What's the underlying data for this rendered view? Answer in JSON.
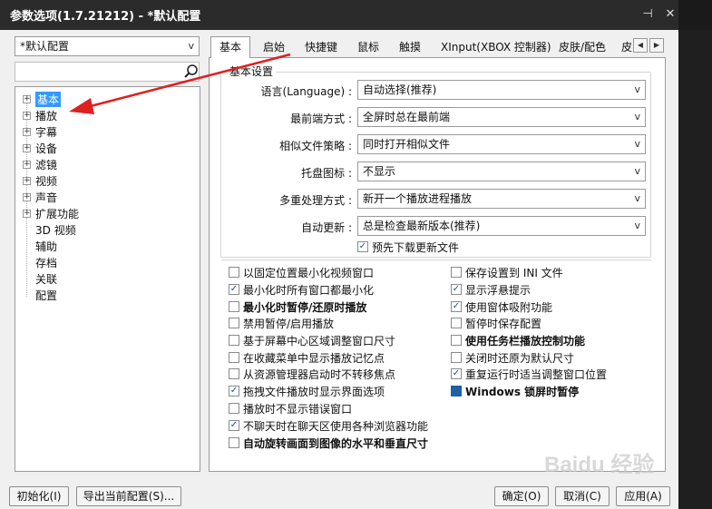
{
  "window": {
    "title": "参数选项(1.7.21212) - *默认配置"
  },
  "profile": {
    "value": "*默认配置",
    "arrow": "v"
  },
  "tree": {
    "items": [
      {
        "label": "基本",
        "expander": "+",
        "selected": true
      },
      {
        "label": "播放",
        "expander": "+"
      },
      {
        "label": "字幕",
        "expander": "+"
      },
      {
        "label": "设备",
        "expander": "+"
      },
      {
        "label": "滤镜",
        "expander": "+"
      },
      {
        "label": "视频",
        "expander": "+"
      },
      {
        "label": "声音",
        "expander": "+"
      },
      {
        "label": "扩展功能",
        "expander": "+"
      },
      {
        "label": "3D 视频"
      },
      {
        "label": "辅助"
      },
      {
        "label": "存档"
      },
      {
        "label": "关联"
      },
      {
        "label": "配置"
      }
    ]
  },
  "tabs": [
    {
      "label": "基本",
      "active": true
    },
    {
      "label": "启始"
    },
    {
      "label": "快捷键"
    },
    {
      "label": "鼠标"
    },
    {
      "label": "触摸"
    },
    {
      "label": "XInput(XBOX 控制器)"
    },
    {
      "label": "皮肤/配色"
    },
    {
      "label": "皮"
    }
  ],
  "tab_scroll": {
    "left": "◀",
    "right": "▶"
  },
  "basic": {
    "group_title": "基本设置",
    "fields": [
      {
        "label": "语言(Language) :",
        "value": "自动选择(推荐)",
        "arrow": "v"
      },
      {
        "label": "最前端方式 :",
        "value": "全屏时总在最前端",
        "arrow": "v"
      },
      {
        "label": "相似文件策略 :",
        "value": "同时打开相似文件",
        "arrow": "v"
      },
      {
        "label": "托盘图标 :",
        "value": "不显示",
        "arrow": "v"
      },
      {
        "label": "多重处理方式 :",
        "value": "新开一个播放进程播放",
        "arrow": "v"
      },
      {
        "label": "自动更新 :",
        "value": "总是检查最新版本(推荐)",
        "arrow": "v"
      }
    ],
    "predownload": {
      "label": "预先下载更新文件",
      "checked": true
    }
  },
  "options_left": [
    {
      "label": "以固定位置最小化视频窗口",
      "checked": false
    },
    {
      "label": "最小化时所有窗口都最小化",
      "checked": true
    },
    {
      "label": "最小化时暂停/还原时播放",
      "checked": false,
      "bold": true
    },
    {
      "label": "禁用暂停/启用播放",
      "checked": false
    },
    {
      "label": "基于屏幕中心区域调整窗口尺寸",
      "checked": false
    },
    {
      "label": "在收藏菜单中显示播放记忆点",
      "checked": false
    },
    {
      "label": "从资源管理器启动时不转移焦点",
      "checked": false
    },
    {
      "label": "拖拽文件播放时显示界面选项",
      "checked": true
    },
    {
      "label": "播放时不显示错误窗口",
      "checked": false
    },
    {
      "label": "不聊天时在聊天区使用各种浏览器功能",
      "checked": true
    },
    {
      "label": "自动旋转画面到图像的水平和垂直尺寸",
      "checked": false,
      "bold": true
    }
  ],
  "options_right": [
    {
      "label": "保存设置到 INI 文件",
      "checked": false
    },
    {
      "label": "显示浮悬提示",
      "checked": true
    },
    {
      "label": "使用窗体吸附功能",
      "checked": true
    },
    {
      "label": "暂停时保存配置",
      "checked": false
    },
    {
      "label": "使用任务栏播放控制功能",
      "checked": false,
      "bold": true
    },
    {
      "label": "关闭时还原为默认尺寸",
      "checked": false
    },
    {
      "label": "重复运行时适当调整窗口位置",
      "checked": true
    },
    {
      "label": "Windows 锁屏时暂停",
      "checked": true,
      "bold": true,
      "blue": true
    }
  ],
  "buttons": {
    "init": "初始化(I)",
    "export": "导出当前配置(S)...",
    "ok": "确定(O)",
    "cancel": "取消(C)",
    "apply": "应用(A)"
  },
  "watermark": "Baidu 经验",
  "colors": {
    "titlebar": "#2b2b2b",
    "selection": "#3399ff",
    "annotation_arrow": "#e02020"
  }
}
